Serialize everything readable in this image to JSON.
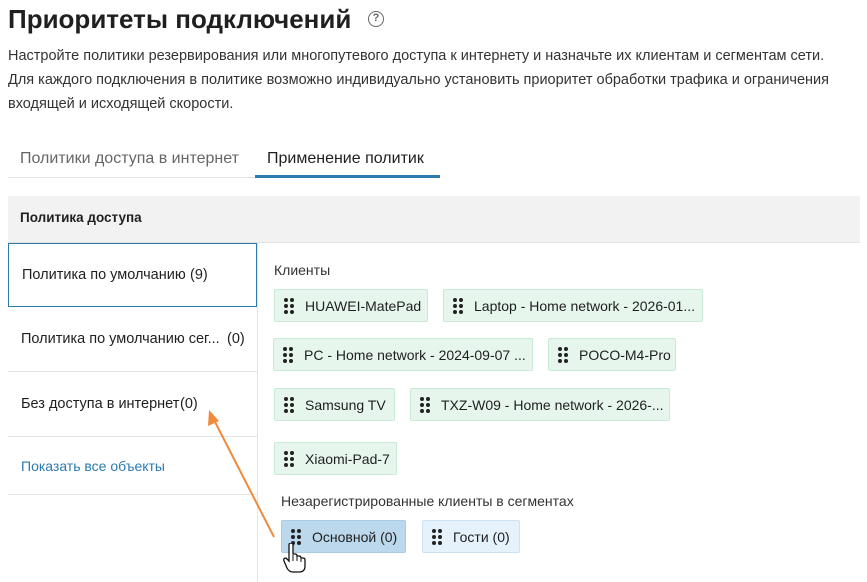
{
  "page": {
    "title": "Приоритеты подключений",
    "help_icon": "help-circle-icon",
    "description": "Настройте политики резервирования или многопутевого доступа к интернету и назначьте их клиентам и сегментам сети. Для каждого подключения в политике возможно индивидуально установить приоритет обработки трафика и ограничения входящей и исходящей скорости."
  },
  "tabs": [
    {
      "label": "Политики доступа в интернет",
      "active": false
    },
    {
      "label": "Применение политик",
      "active": true
    }
  ],
  "policy_panel": {
    "header": "Политика доступа",
    "items": [
      {
        "name": "Политика по умолчанию",
        "count": "(9)",
        "active": true
      },
      {
        "name": "Политика по умолчанию сег...",
        "count": "(0)",
        "active": false
      },
      {
        "name": "Без доступа в интернет",
        "count": "(0)",
        "active": false
      }
    ],
    "show_all": "Показать все объекты"
  },
  "clients": {
    "label": "Клиенты",
    "items": [
      "HUAWEI-MatePad",
      "Laptop - Home network - 2026-01...",
      "PC - Home network - 2024-09-07 ...",
      "POCO-M4-Pro",
      "Samsung TV",
      "TXZ-W09 - Home network - 2026-...",
      "Xiaomi-Pad-7"
    ]
  },
  "segments": {
    "label": "Незарегистрированные клиенты в сегментах",
    "items": [
      {
        "name": "Основной (0)",
        "selected": true
      },
      {
        "name": "Гости (0)",
        "selected": false
      }
    ]
  },
  "colors": {
    "accent": "#2a7bb0",
    "client_chip_bg": "#e6f6ec",
    "segment_chip_bg": "#e6f2fb",
    "segment_chip_selected_bg": "#bcd8ec",
    "annotation_arrow": "#f08a3c"
  }
}
